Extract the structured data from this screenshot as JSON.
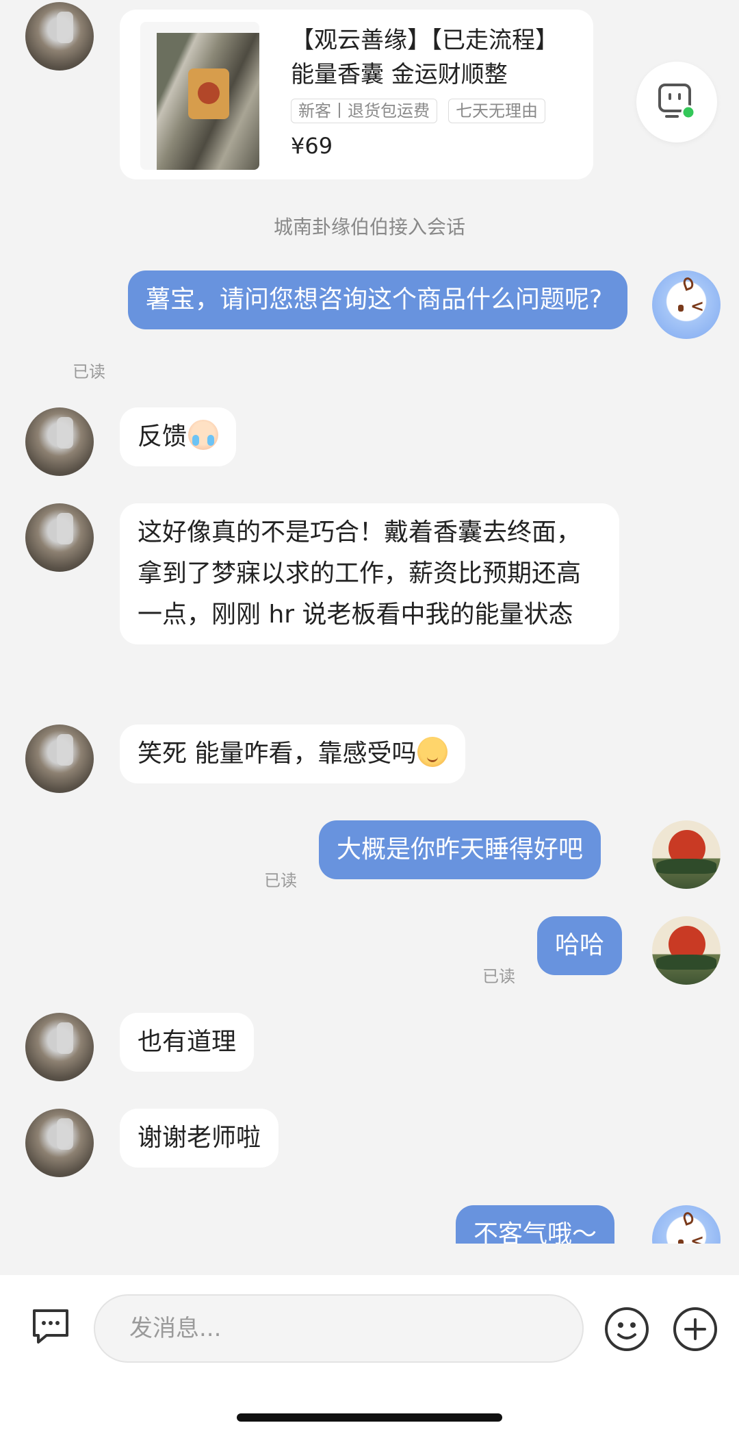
{
  "product": {
    "title": "【观云善缘】【已走流程】能量香囊 金运财顺整",
    "tags": [
      "新客丨退货包运费",
      "七天无理由"
    ],
    "price": "¥69"
  },
  "system_notice": "城南卦缘伯伯接入会话",
  "read_label": "已读",
  "messages": {
    "m1": "薯宝，请问您想咨询这个商品什么问题呢?",
    "m2": "反馈",
    "m3": "这好像真的不是巧合！戴着香囊去终面，拿到了梦寐以求的工作，薪资比预期还高一点，刚刚 hr 说老板看中我的能量状态",
    "m4": "笑死 能量咋看，靠感受吗",
    "m5": "大概是你昨天睡得好吧",
    "m6": "哈哈",
    "m7": "也有道理",
    "m8": "谢谢老师啦",
    "m9": "不客气哦～"
  },
  "composer": {
    "placeholder": "发消息..."
  },
  "icons": {
    "keyboard": "message-icon",
    "emoji": "emoji-icon",
    "plus": "plus-icon",
    "service": "customer-service-icon"
  },
  "colors": {
    "outgoing_bubble": "#6893de",
    "online_dot": "#34c759"
  }
}
